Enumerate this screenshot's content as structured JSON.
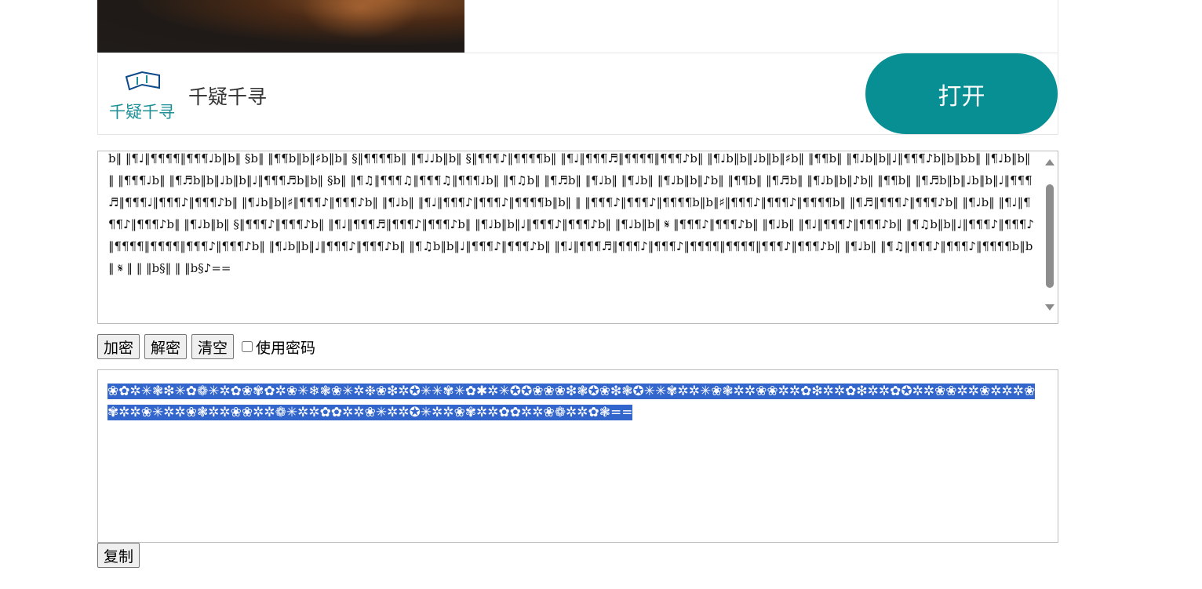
{
  "ad": {
    "app_name": "千疑千寻",
    "logo_text": "千疑千寻",
    "open_label": "打开",
    "brand_color": "#078f94",
    "logo_icon": "message-flag-icon"
  },
  "encoder": {
    "encoded_text": "b‖ ‖¶♩‖¶¶¶¶‖¶¶¶♩b‖b‖ §b‖ ‖¶¶b‖b‖♯b‖b‖ §‖¶¶¶¶b‖ ‖¶♩♩b‖b‖ §‖¶¶¶♪‖¶¶¶¶b‖ ‖¶♩‖¶¶¶♬‖¶¶¶¶‖¶¶¶♪b‖ ‖¶♩b‖b‖♩b‖b‖♯b‖ ‖¶¶b‖ ‖¶♩b‖b‖♩‖¶¶¶♪b‖b‖bb‖ ‖¶♩b‖b‖ ‖ ‖¶¶¶♩b‖ ‖¶♬b‖b‖♩b‖b‖♩‖¶¶¶♬b‖b‖ §b‖ ‖¶♫‖¶¶¶♫‖¶¶¶♫‖¶¶¶♩b‖ ‖¶♫b‖ ‖¶♬b‖ ‖¶♩b‖ ‖¶♩b‖ ‖¶♩b‖b‖♪b‖ ‖¶¶b‖ ‖¶♬b‖ ‖¶♩b‖b‖♪b‖ ‖¶¶b‖ ‖¶♬b‖b‖♩b‖b‖♩‖¶¶¶♬‖¶¶¶♩‖¶¶¶♪‖¶¶¶♪b‖ ‖¶♩b‖b‖♯‖¶¶¶♪‖¶¶¶♪b‖ ‖¶♩b‖ ‖¶♩‖¶¶¶♪‖¶¶¶♪‖¶¶¶¶b‖b‖ ‖ ‖¶¶¶♪‖¶¶¶♪‖¶¶¶¶b‖b‖♯‖¶¶¶♪‖¶¶¶♪‖¶¶¶¶b‖ ‖¶♬‖¶¶¶♪‖¶¶¶♪b‖ ‖¶♩b‖ ‖¶♩‖¶¶¶♪‖¶¶¶♪b‖ ‖¶♩b‖b‖ §‖¶¶¶♪‖¶¶¶♪b‖ ‖¶♩‖¶¶¶♬‖¶¶¶♪‖¶¶¶♪b‖ ‖¶♩b‖b‖♩‖¶¶¶♪‖¶¶¶♪b‖ ‖¶♩b‖b‖ 𝄋 ‖¶¶¶♪‖¶¶¶♪b‖ ‖¶♩b‖ ‖¶♩‖¶¶¶♪‖¶¶¶♪b‖ ‖¶♫b‖b‖♩‖¶¶¶♪‖¶¶¶♪‖¶¶¶¶‖¶¶¶¶‖¶¶¶♪‖¶¶¶♪b‖ ‖¶♩b‖b‖♩‖¶¶¶♪‖¶¶¶♪b‖ ‖¶♫b‖b‖♩‖¶¶¶♪‖¶¶¶♪b‖ ‖¶♩‖¶¶¶♬‖¶¶¶♪‖¶¶¶♪‖¶¶¶¶‖¶¶¶¶‖¶¶¶♪‖¶¶¶♪b‖ ‖¶♩b‖ ‖¶♫‖¶¶¶♪‖¶¶¶♪‖¶¶¶¶b‖b‖ 𝄋 ‖ ‖ ‖b§‖ ‖ ‖b§♪==",
    "encrypt_label": "加密",
    "decrypt_label": "解密",
    "clear_label": "清空",
    "use_password_label": "使用密码",
    "use_password_checked": false,
    "output_text": "❀✿✲✳❃❇✳✿❁✳✲✿❀✾✿✲❀✳❄❃❀✳✲❉❀❇✲✪✳✳✾✳✿✱✲✳✪✪❀❀❀❇❃✪❀❇❃✪✳✳✾✲✲✳❀❃✲✲❀❀✲✲✿❇✲✲✿❇✲✲✿✪✲✲❀❀✲✲❀✲✲✲❀✾✲✲❀✳✲✲❀❃✲✲❀❀✲✲❁✳✲✲✿✿✲✲❀✳✲✲✪✳✲✲❀✾✲✲✿✿✲✲❀❁✲✲✿❃==",
    "copy_label": "复制"
  }
}
